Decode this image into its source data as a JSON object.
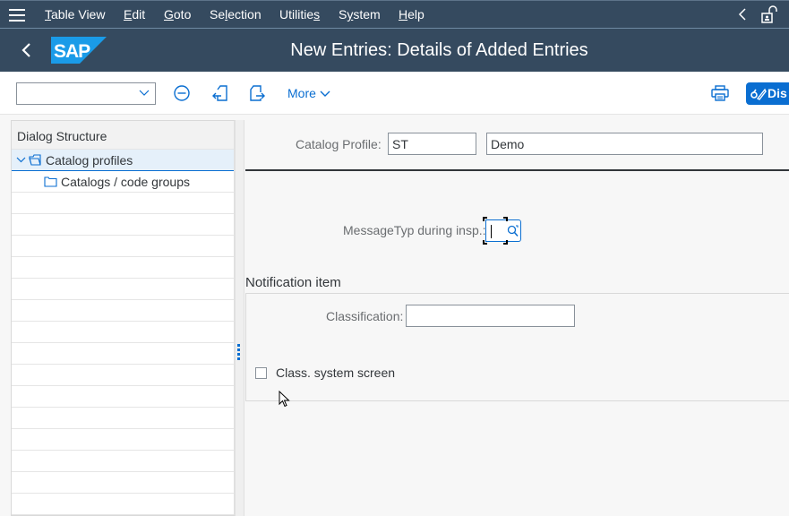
{
  "menubar": {
    "items": [
      {
        "label": "Table View",
        "mnemonic": "T"
      },
      {
        "label": "Edit",
        "mnemonic": "E"
      },
      {
        "label": "Goto",
        "mnemonic": "G"
      },
      {
        "label": "Selection",
        "mnemonic": "l"
      },
      {
        "label": "Utilities",
        "mnemonic": "s"
      },
      {
        "label": "System",
        "mnemonic": "y"
      },
      {
        "label": "Help",
        "mnemonic": "H"
      }
    ],
    "icons": [
      "menu-icon",
      "collapse-chevron-icon",
      "unlock-icon"
    ]
  },
  "titlebar": {
    "title": "New Entries: Details of Added Entries",
    "logo": "SAP"
  },
  "toolbar": {
    "command_value": "",
    "more_label": "More",
    "display_label": "Dis",
    "colors": {
      "accent": "#0a6ed1",
      "shell": "#354a5f"
    }
  },
  "dialog_structure": {
    "header": "Dialog Structure",
    "items": [
      {
        "label": "Catalog profiles",
        "selected": true,
        "expanded": true,
        "level": 0
      },
      {
        "label": "Catalogs / code groups",
        "selected": false,
        "level": 1
      }
    ]
  },
  "form": {
    "catalog_profile_label": "Catalog Profile:",
    "catalog_profile_code": "ST",
    "catalog_profile_desc": "Demo",
    "message_type_label": "MessageTyp during insp.:",
    "message_type_value": "",
    "notification_group_title": "Notification item",
    "classification_label": "Classification:",
    "classification_value": "",
    "class_system_screen_label": "Class. system screen",
    "class_system_screen_checked": false
  }
}
